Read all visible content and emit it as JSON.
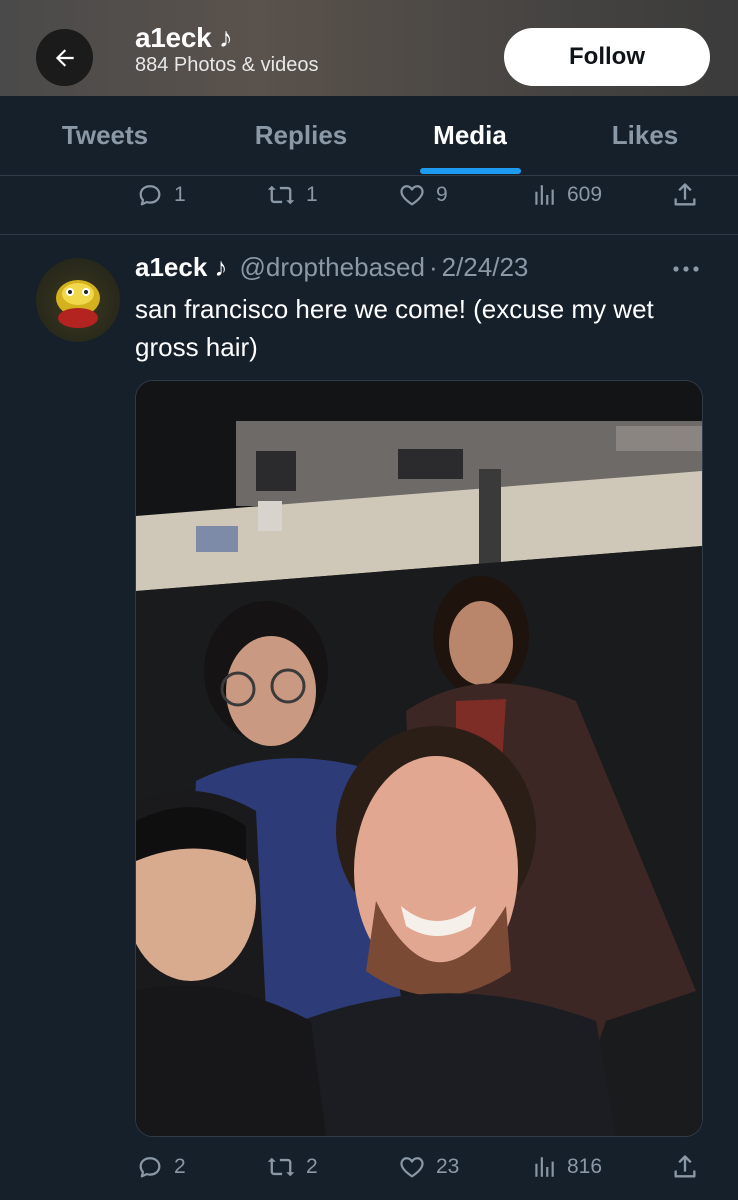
{
  "header": {
    "back_icon": "arrow-left-icon",
    "profile_name": "a1eck ♪",
    "profile_subtitle": "884 Photos & videos",
    "follow_label": "Follow"
  },
  "tabs": [
    {
      "label": "Tweets",
      "active": false
    },
    {
      "label": "Replies",
      "active": false
    },
    {
      "label": "Media",
      "active": true
    },
    {
      "label": "Likes",
      "active": false
    }
  ],
  "prev_tweet_actions": {
    "replies": "1",
    "retweets": "1",
    "likes": "9",
    "views": "609"
  },
  "tweet": {
    "name": "a1eck ♪",
    "handle": "@dropthebased",
    "separator": "·",
    "date": "2/24/23",
    "text": "san francisco here we come! (excuse my wet gross hair)",
    "actions": {
      "replies": "2",
      "retweets": "2",
      "likes": "23",
      "views": "816"
    }
  },
  "colors": {
    "background": "#15202b",
    "accent": "#1d9bf0",
    "secondary_text": "#8b98a5"
  }
}
